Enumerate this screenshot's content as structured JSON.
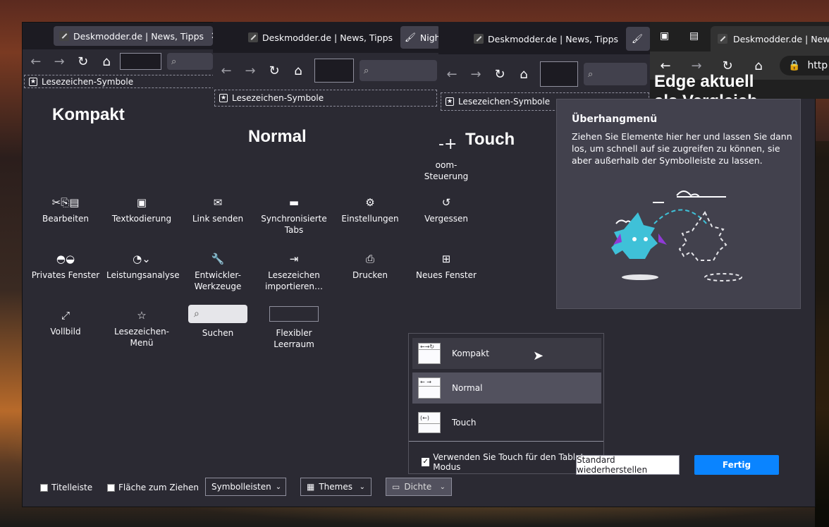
{
  "tab_title": "Deskmodder.de | News, Tipps",
  "tab_title_short": "Nigh",
  "bookmarks_toolbar_label": "Lesezeichen-Symbole",
  "labels": {
    "compact": "Kompakt",
    "normal": "Normal",
    "touch": "Touch",
    "edge_caption_line1": "Edge aktuell",
    "edge_caption_line2": "als Vergleich"
  },
  "edge": {
    "tab_title": "Deskmodder.de | News, Ti",
    "address_fragment": "http"
  },
  "palette": {
    "zoom_label_line1": "oom-",
    "zoom_label_line2": "Steuerung",
    "items": [
      {
        "label": "Bearbeiten",
        "icon": "cut-copy-paste-icon"
      },
      {
        "label": "Textkodierung",
        "icon": "text-encoding-icon"
      },
      {
        "label": "Link senden",
        "icon": "mail-icon"
      },
      {
        "label": "Synchronisierte Tabs",
        "icon": "laptop-icon"
      },
      {
        "label": "Einstellungen",
        "icon": "gear-icon"
      },
      {
        "label": "Vergessen",
        "icon": "history-icon"
      },
      {
        "label": "Privates Fenster",
        "icon": "mask-icon"
      },
      {
        "label": "Leistungsanalyse",
        "icon": "gauge-icon"
      },
      {
        "label": "Entwickler-Werkzeuge",
        "icon": "wrench-icon"
      },
      {
        "label": "Lesezeichen importieren…",
        "icon": "import-icon"
      },
      {
        "label": "Drucken",
        "icon": "printer-icon"
      },
      {
        "label": "Neues Fenster",
        "icon": "new-window-icon"
      },
      {
        "label": "Vollbild",
        "icon": "fullscreen-icon"
      },
      {
        "label": "Lesezeichen-Menü",
        "icon": "bookmark-star-icon"
      },
      {
        "label": "Suchen",
        "icon": "search-icon"
      },
      {
        "label": "Flexibler Leerraum",
        "icon": "flexible-space"
      }
    ]
  },
  "overflow": {
    "title": "Überhangmenü",
    "description": "Ziehen Sie Elemente hier her und lassen Sie dann los, um schnell auf sie zugreifen zu können, sie aber außerhalb der Symbolleiste zu lassen."
  },
  "density": {
    "options": [
      "Kompakt",
      "Normal",
      "Touch"
    ],
    "selected": "Normal",
    "tablet_checkbox": "Verwenden Sie Touch für den Tablet-Modus"
  },
  "bottom": {
    "titlebar": "Titelleiste",
    "drag_space": "Fläche zum Ziehen",
    "toolbars": "Symbolleisten",
    "themes": "Themes",
    "density": "Dichte",
    "restore": "Standard wiederherstellen",
    "done": "Fertig"
  },
  "colors": {
    "accent": "#0a84ff",
    "panel_bg": "#2b2a33",
    "toolbar_bg": "#1c1b22",
    "dragon": "#3fc1d8",
    "dragon_horns": "#8f3ad6"
  }
}
